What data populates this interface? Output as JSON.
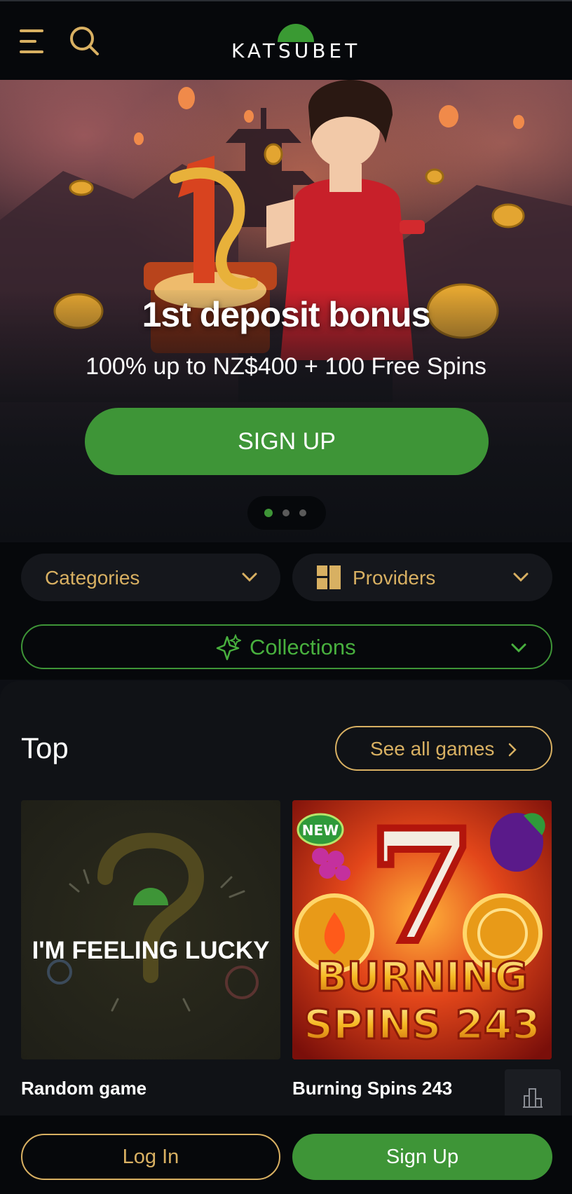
{
  "header": {
    "logo_text": "KATSUBET"
  },
  "hero": {
    "title": "1st deposit bonus",
    "subtitle": "100% up to NZ$400 + 100 Free Spins",
    "cta_label": "SIGN UP",
    "carousel": {
      "slides": 3,
      "active_index": 0
    }
  },
  "filters": {
    "categories_label": "Categories",
    "providers_label": "Providers",
    "collections_label": "Collections"
  },
  "top_section": {
    "title": "Top",
    "see_all_label": "See all games",
    "games": [
      {
        "card_text": "I'M FEELING LUCKY",
        "name": "Random game"
      },
      {
        "badge": "NEW",
        "art_number": "7",
        "art_line1": "BURNING",
        "art_line2": "SPINS 243",
        "name": "Burning Spins 243"
      }
    ]
  },
  "bottom_bar": {
    "login_label": "Log In",
    "signup_label": "Sign Up"
  },
  "colors": {
    "accent_gold": "#d8b062",
    "brand_green": "#3e9537",
    "background": "#0d0f14"
  },
  "icons": [
    "menu-icon",
    "search-icon",
    "chevron-down-icon",
    "providers-grid-icon",
    "sparkle-icon",
    "chevron-right-icon",
    "stats-icon"
  ]
}
